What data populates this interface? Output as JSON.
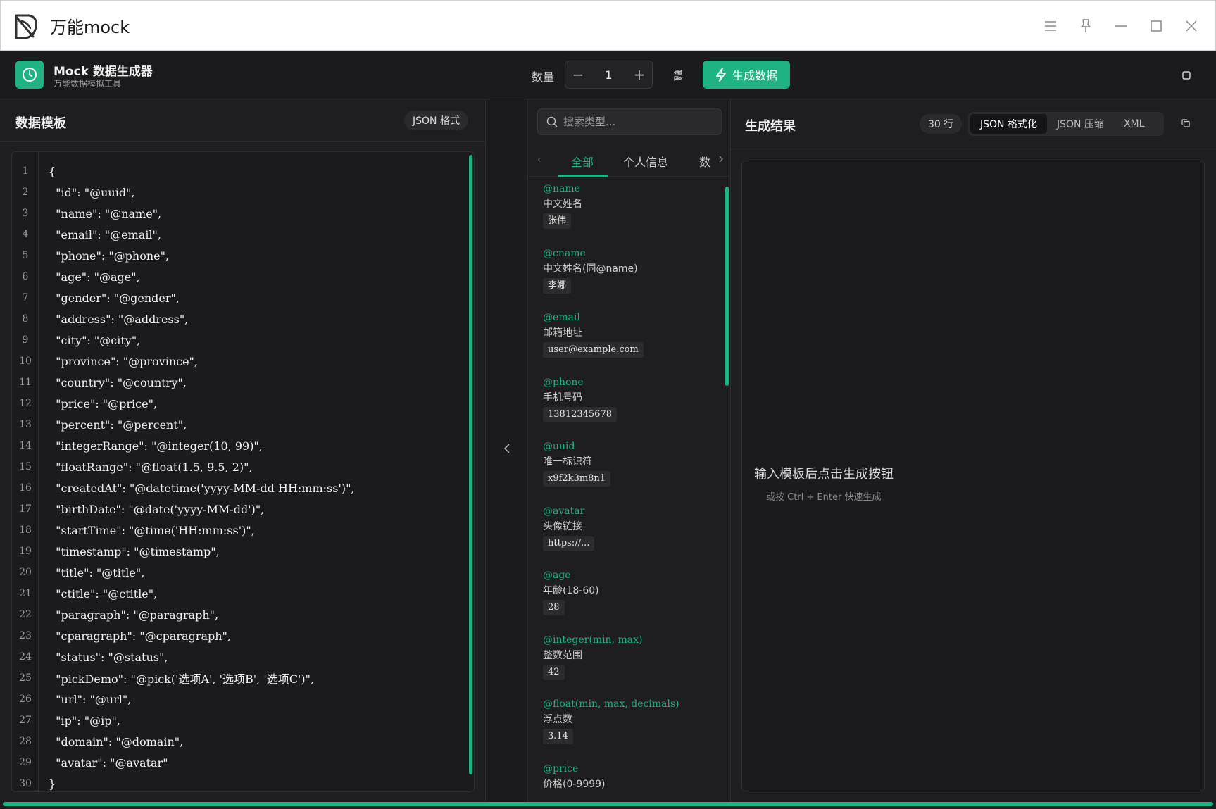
{
  "window": {
    "title": "万能mock"
  },
  "toolbar": {
    "brand_title": "Mock 数据生成器",
    "brand_subtitle": "万能数据模拟工具",
    "quantity_label": "数量",
    "quantity_value": "1",
    "decrement": "−",
    "increment": "+",
    "generate_label": "生成数据"
  },
  "template_panel": {
    "title": "数据模板",
    "format_badge": "JSON 格式",
    "lines": [
      {
        "n": "1",
        "text": "{"
      },
      {
        "n": "2",
        "text": "  \"id\": \"@uuid\","
      },
      {
        "n": "3",
        "text": "  \"name\": \"@name\","
      },
      {
        "n": "4",
        "text": "  \"email\": \"@email\","
      },
      {
        "n": "5",
        "text": "  \"phone\": \"@phone\","
      },
      {
        "n": "6",
        "text": "  \"age\": \"@age\","
      },
      {
        "n": "7",
        "text": "  \"gender\": \"@gender\","
      },
      {
        "n": "8",
        "text": "  \"address\": \"@address\","
      },
      {
        "n": "9",
        "text": "  \"city\": \"@city\","
      },
      {
        "n": "10",
        "text": "  \"province\": \"@province\","
      },
      {
        "n": "11",
        "text": "  \"country\": \"@country\","
      },
      {
        "n": "12",
        "text": "  \"price\": \"@price\","
      },
      {
        "n": "13",
        "text": "  \"percent\": \"@percent\","
      },
      {
        "n": "14",
        "text": "  \"integerRange\": \"@integer(10, 99)\","
      },
      {
        "n": "15",
        "text": "  \"floatRange\": \"@float(1.5, 9.5, 2)\","
      },
      {
        "n": "16",
        "text": "  \"createdAt\": \"@datetime('yyyy-MM-dd HH:mm:ss')\","
      },
      {
        "n": "17",
        "text": "  \"birthDate\": \"@date('yyyy-MM-dd')\","
      },
      {
        "n": "18",
        "text": "  \"startTime\": \"@time('HH:mm:ss')\","
      },
      {
        "n": "19",
        "text": "  \"timestamp\": \"@timestamp\","
      },
      {
        "n": "20",
        "text": "  \"title\": \"@title\","
      },
      {
        "n": "21",
        "text": "  \"ctitle\": \"@ctitle\","
      },
      {
        "n": "22",
        "text": "  \"paragraph\": \"@paragraph\","
      },
      {
        "n": "23",
        "text": "  \"cparagraph\": \"@cparagraph\","
      },
      {
        "n": "24",
        "text": "  \"status\": \"@status\","
      },
      {
        "n": "25",
        "text": "  \"pickDemo\": \"@pick('选项A', '选项B', '选项C')\","
      },
      {
        "n": "26",
        "text": "  \"url\": \"@url\","
      },
      {
        "n": "27",
        "text": "  \"ip\": \"@ip\","
      },
      {
        "n": "28",
        "text": "  \"domain\": \"@domain\","
      },
      {
        "n": "29",
        "text": "  \"avatar\": \"@avatar\""
      },
      {
        "n": "30",
        "text": "}"
      }
    ]
  },
  "types_panel": {
    "search_placeholder": "搜索类型...",
    "tabs": [
      "全部",
      "个人信息",
      "数"
    ],
    "active_tab": "全部",
    "items": [
      {
        "code": "@name",
        "desc": "中文姓名",
        "example": "张伟"
      },
      {
        "code": "@cname",
        "desc": "中文姓名(同@name)",
        "example": "李娜"
      },
      {
        "code": "@email",
        "desc": "邮箱地址",
        "example": "user@example.com"
      },
      {
        "code": "@phone",
        "desc": "手机号码",
        "example": "13812345678"
      },
      {
        "code": "@uuid",
        "desc": "唯一标识符",
        "example": "x9f2k3m8n1"
      },
      {
        "code": "@avatar",
        "desc": "头像链接",
        "example": "https://..."
      },
      {
        "code": "@age",
        "desc": "年龄(18-60)",
        "example": "28"
      },
      {
        "code": "@integer(min, max)",
        "desc": "整数范围",
        "example": "42"
      },
      {
        "code": "@float(min, max, decimals)",
        "desc": "浮点数",
        "example": "3.14"
      },
      {
        "code": "@price",
        "desc": "价格(0-9999)",
        "example": ""
      }
    ]
  },
  "result_panel": {
    "title": "生成结果",
    "rows_badge": "30 行",
    "formats": [
      "JSON 格式化",
      "JSON 压缩",
      "XML"
    ],
    "active_format": "JSON 格式化",
    "empty_title": "输入模板后点击生成按钮",
    "empty_hint": "或按 Ctrl + Enter 快速生成"
  },
  "colors": {
    "accent": "#1fb383",
    "background": "#1e1e20",
    "titlebar": "#ffffff"
  },
  "icons": [
    "app-logo-icon",
    "menu-icon",
    "pin-icon",
    "minimize-icon",
    "maximize-icon",
    "close-icon",
    "clock-icon",
    "shuffle-icon",
    "lightning-icon",
    "square-icon",
    "chevron-left-icon",
    "search-icon",
    "chevron-right-icon",
    "copy-icon"
  ]
}
